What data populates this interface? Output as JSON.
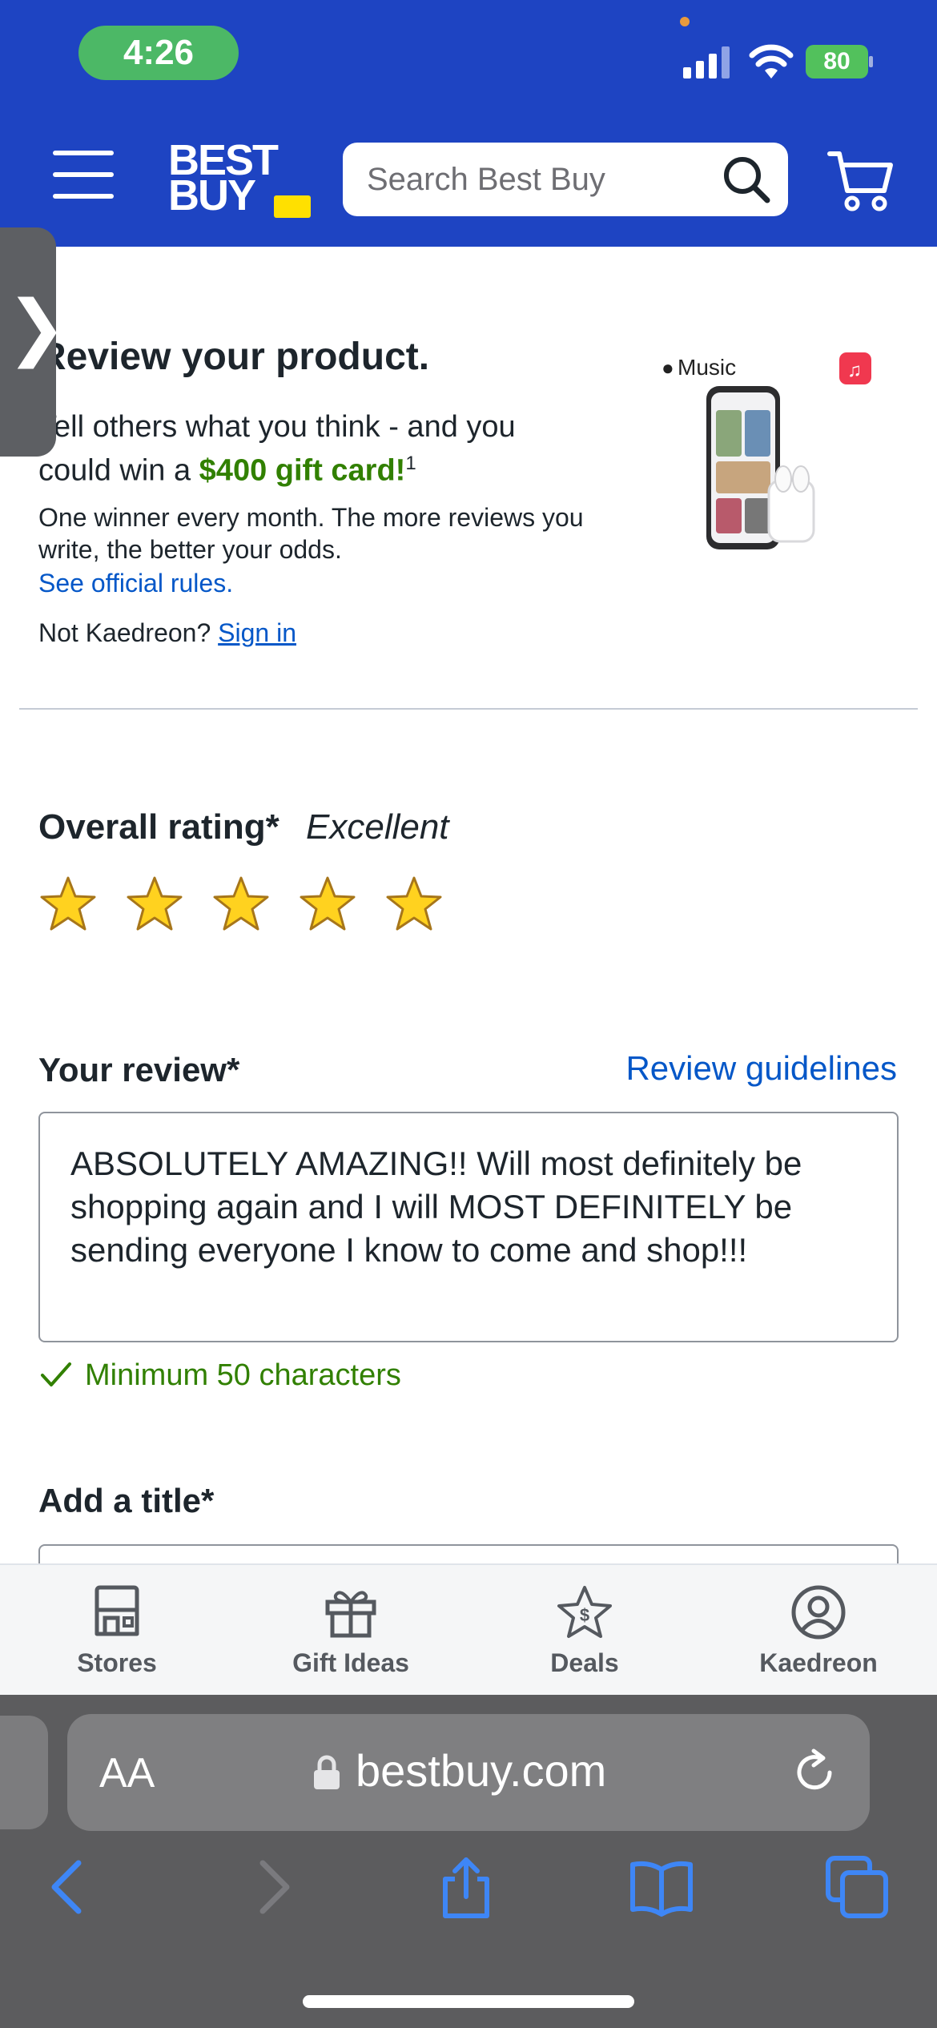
{
  "status_bar": {
    "time": "4:26",
    "battery": "80"
  },
  "header": {
    "logo_line1": "BEST",
    "logo_line2": "BUY",
    "search_placeholder": "Search Best Buy"
  },
  "promo": {
    "title": "Review your product.",
    "line1": "Tell others what you think - and you",
    "line2_prefix": "could win a ",
    "line2_highlight": "$400 gift card!",
    "footnote": "1",
    "subtext": "One winner every month. The more reviews you write, the better your odds.",
    "rules_link": "See official rules.",
    "not_user_prefix": "Not Kaedreon?",
    "sign_in": "Sign in",
    "image_brand": "Music"
  },
  "rating": {
    "label": "Overall rating*",
    "value_text": "Excellent",
    "stars": 5,
    "max_stars": 5
  },
  "review": {
    "label": "Your review*",
    "guidelines_link": "Review guidelines",
    "text": "ABSOLUTELY AMAZING!! Will most definitely be shopping again and I will MOST DEFINITELY be sending everyone I know to come and shop!!!",
    "min_chars": "Minimum 50 characters"
  },
  "title_section": {
    "label": "Add a title*"
  },
  "bottom_nav": [
    {
      "label": "Stores",
      "icon": "store-icon"
    },
    {
      "label": "Gift Ideas",
      "icon": "gift-icon"
    },
    {
      "label": "Deals",
      "icon": "deals-icon"
    },
    {
      "label": "Kaedreon",
      "icon": "account-icon"
    }
  ],
  "browser": {
    "aa": "AA",
    "url": "bestbuy.com"
  },
  "colors": {
    "brand_blue": "#1e44c2",
    "link_blue": "#0457c8",
    "success_green": "#318000",
    "star_yellow": "#ffd21f"
  }
}
